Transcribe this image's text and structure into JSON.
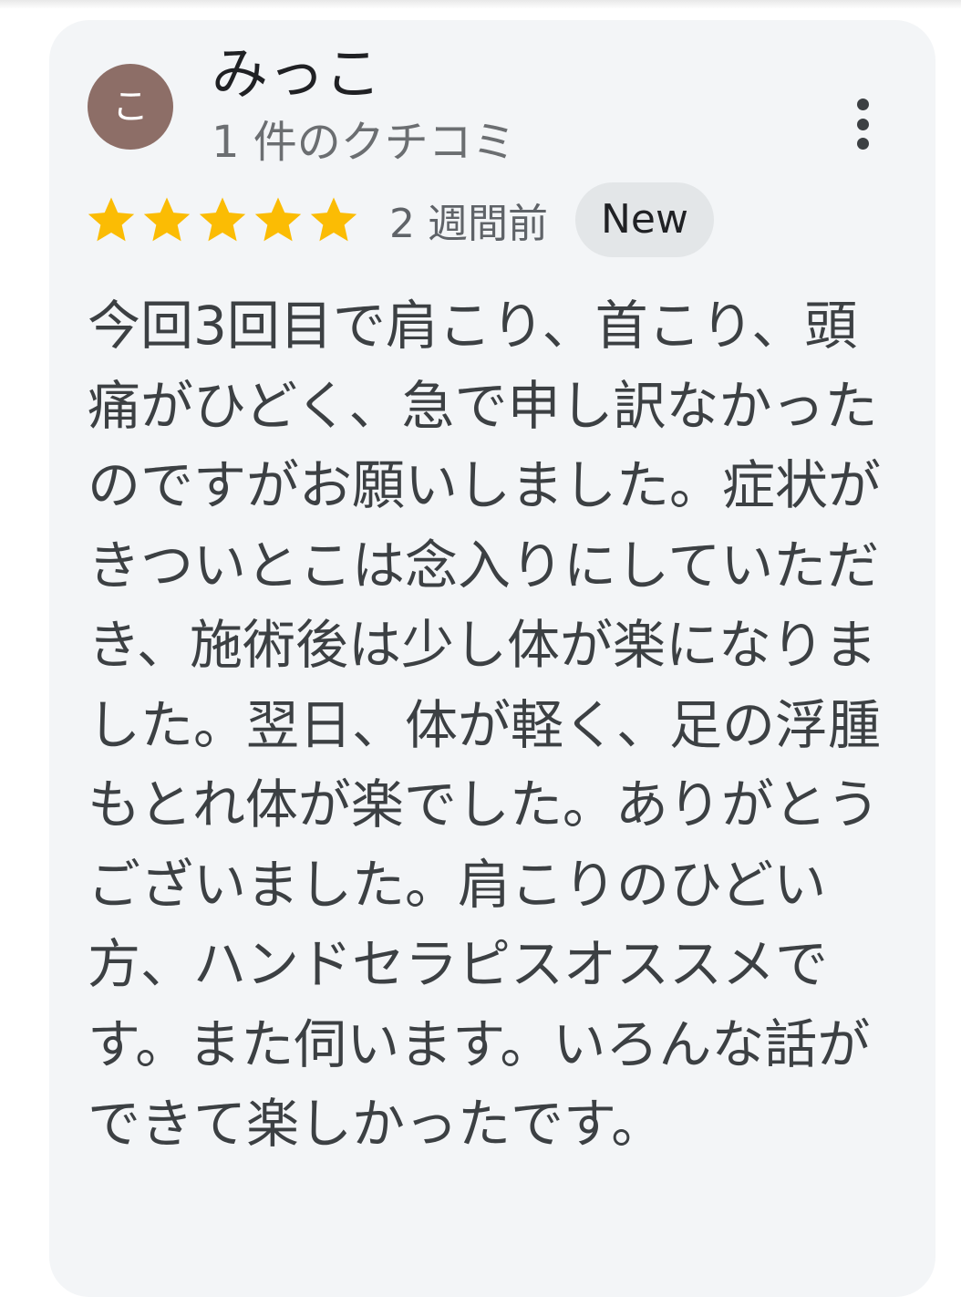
{
  "review": {
    "author": {
      "initial": "こ",
      "name": "みっこ",
      "review_count": "1 件のクチコミ",
      "avatar_color": "#8d6e67"
    },
    "rating": 5,
    "max_rating": 5,
    "star_color": "#fbbc04",
    "time_ago": "2 週間前",
    "badge": "New",
    "more_icon": "more-vert-icon",
    "text": "今回3回目で肩こり、首こり、頭痛がひどく、急で申し訳なかったのですがお願いしました。症状がきついとこは念入りにしていただき、施術後は少し体が楽になりました。翌日、体が軽く、足の浮腫もとれ体が楽でした。ありがとうございました。肩こりのひどい方、ハンドセラピスオススメです。また伺います。いろんな話ができて楽しかったです。"
  }
}
